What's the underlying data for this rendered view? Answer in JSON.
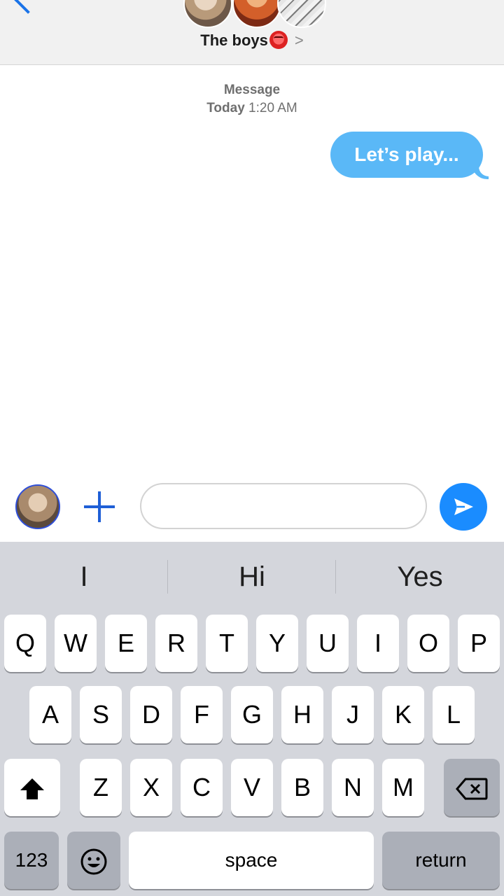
{
  "header": {
    "group_name": "The boys",
    "chevron": ">"
  },
  "thread": {
    "timestamp_label": "Message",
    "timestamp_day": "Today",
    "timestamp_time": "1:20 AM",
    "messages": [
      {
        "text": "Let’s play...",
        "direction": "outgoing",
        "color": "#5ab8f7"
      }
    ]
  },
  "composer": {
    "value": "",
    "placeholder": ""
  },
  "keyboard": {
    "suggestions": [
      "I",
      "Hi",
      "Yes"
    ],
    "row1": [
      "Q",
      "W",
      "E",
      "R",
      "T",
      "Y",
      "U",
      "I",
      "O",
      "P"
    ],
    "row2": [
      "A",
      "S",
      "D",
      "F",
      "G",
      "H",
      "J",
      "K",
      "L"
    ],
    "row3": [
      "Z",
      "X",
      "C",
      "V",
      "B",
      "N",
      "M"
    ],
    "numbers_label": "123",
    "space_label": "space",
    "return_label": "return"
  },
  "colors": {
    "accent": "#1a8cff",
    "bubble": "#5ab8f7",
    "keyboard_bg": "#d4d6dc"
  },
  "icons": [
    "back-chevron-icon",
    "plus-icon",
    "send-icon",
    "shift-icon",
    "delete-icon",
    "emoji-icon"
  ]
}
